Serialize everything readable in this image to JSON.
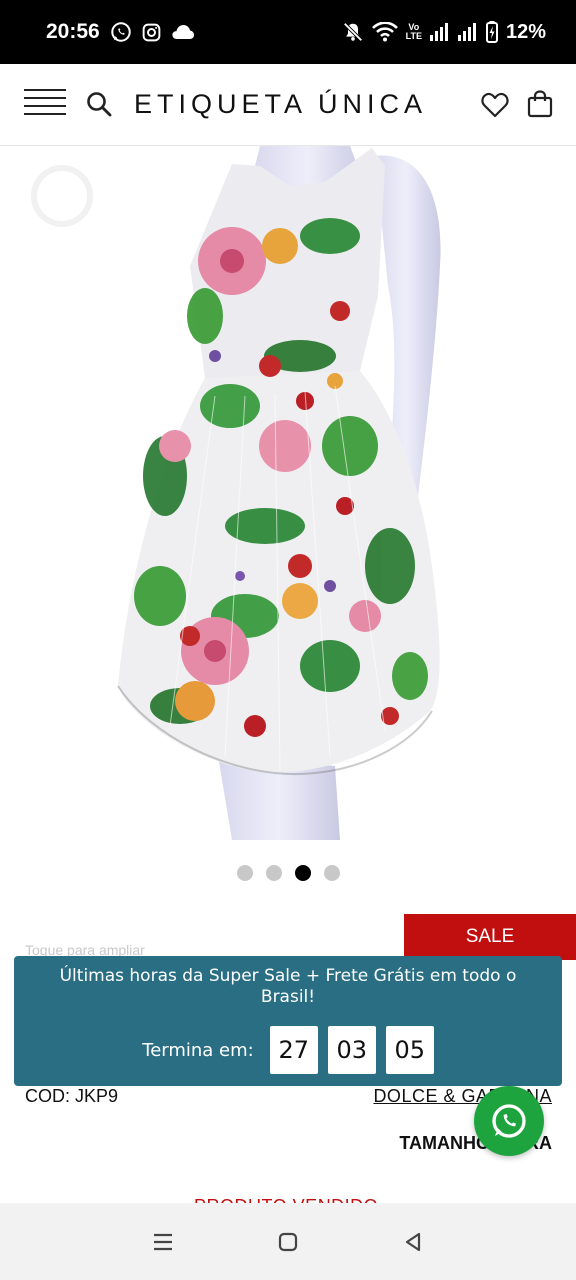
{
  "status_bar": {
    "time": "20:56",
    "volte": [
      "Vo",
      "LTE"
    ],
    "battery": "12%"
  },
  "header": {
    "brand": "ETIQUETA ÚNICA"
  },
  "gallery": {
    "dot_count": 4,
    "active_index": 2,
    "hint": "Toque para ampliar"
  },
  "product": {
    "sale_badge": "SALE",
    "code": "COD: JKP9",
    "brand": "DOLCE & GABBANA",
    "size_label": "TAMANHO: FORA",
    "status": "PRODUTO VENDIDO"
  },
  "promo": {
    "text": "Últimas horas da Super Sale + Frete Grátis em todo o Brasil!",
    "countdown_label": "Termina em:",
    "countdown": [
      "27",
      "03",
      "05"
    ]
  },
  "colors": {
    "accent_red": "#c10f0f",
    "promo_bg": "#2a6e84",
    "whatsapp": "#1ea43f"
  },
  "icons": [
    "whatsapp-icon",
    "instagram-icon",
    "cloud-icon",
    "mute-icon",
    "wifi-icon",
    "signal-icon",
    "battery-icon",
    "menu-icon",
    "search-icon",
    "heart-icon",
    "bag-icon",
    "nav-recent-icon",
    "nav-home-icon",
    "nav-back-icon"
  ]
}
